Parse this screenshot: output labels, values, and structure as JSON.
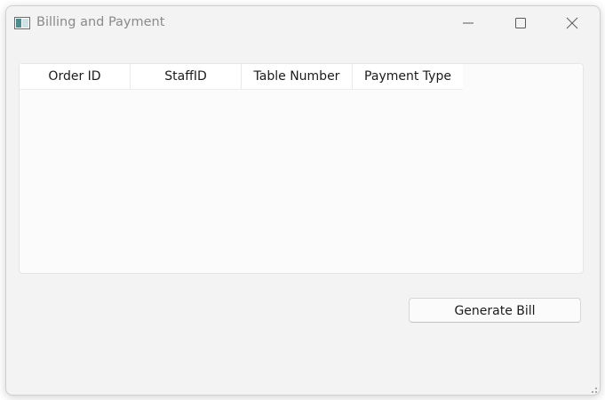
{
  "window": {
    "title": "Billing and Payment"
  },
  "table": {
    "columns": [
      "Order ID",
      "StaffID",
      "Table Number",
      "Payment Type"
    ],
    "rows": []
  },
  "actions": {
    "generate_bill_label": "Generate Bill"
  },
  "icons": {
    "app": "app-window-icon",
    "minimize": "minimize-icon",
    "maximize": "maximize-icon",
    "close": "close-icon",
    "resize": "resize-grip-icon"
  },
  "colors": {
    "window_bg": "#f3f3f3",
    "table_bg": "#fbfbfb",
    "title_text": "#8a8a8a",
    "text": "#1b1b1b"
  }
}
